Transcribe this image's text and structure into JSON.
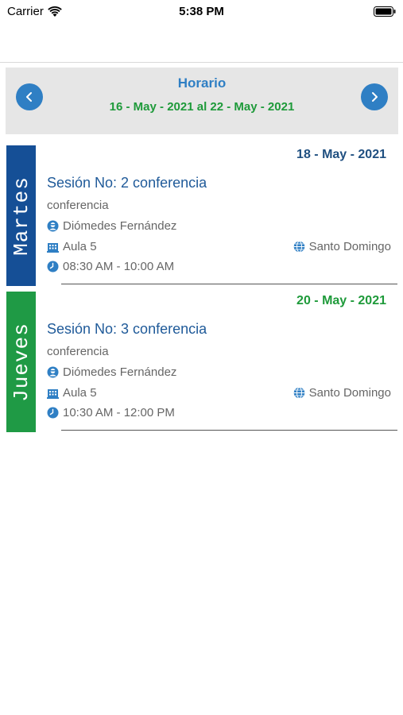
{
  "status_bar": {
    "carrier": "Carrier",
    "time": "5:38 PM"
  },
  "header": {
    "title": "Horario",
    "range": "16 - May - 2021 al 22 - May - 2021",
    "title_color": "#2f7fc4",
    "range_color": "#1e9a3a"
  },
  "sessions": [
    {
      "day": "Martes",
      "day_color": "#154f96",
      "date": "18 - May - 2021",
      "date_color": "#1f4f80",
      "title": "Sesión No: 2 conferencia",
      "subtitle": "conferencia",
      "speaker": "Diómedes Fernández",
      "room": "Aula 5",
      "location": "Santo Domingo",
      "time": "08:30 AM - 10:00 AM"
    },
    {
      "day": "Jueves",
      "day_color": "#1f9a45",
      "date": "20 - May - 2021",
      "date_color": "#1e9a3a",
      "title": "Sesión No: 3 conferencia",
      "subtitle": "conferencia",
      "speaker": "Diómedes Fernández",
      "room": "Aula 5",
      "location": "Santo Domingo",
      "time": "10:30 AM - 12:00 PM"
    }
  ],
  "icons": {
    "prev": "chevron-left-icon",
    "next": "chevron-right-icon",
    "speaker": "person-icon",
    "room": "building-icon",
    "location": "globe-icon",
    "time": "clock-icon"
  }
}
